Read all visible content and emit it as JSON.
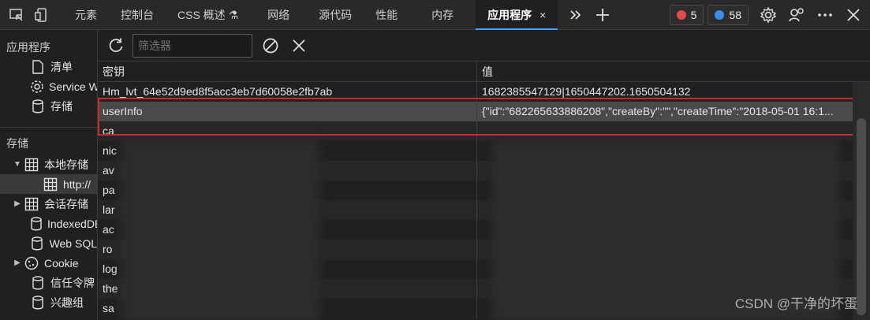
{
  "toolbar": {
    "tabs": [
      {
        "label": "元素"
      },
      {
        "label": "控制台"
      },
      {
        "label": "CSS 概述 ⚗"
      },
      {
        "label": "网络"
      },
      {
        "label": "源代码"
      },
      {
        "label": "性能"
      },
      {
        "label": "内存"
      },
      {
        "label": "应用程序",
        "close": "×"
      }
    ],
    "error_count": "5",
    "message_count": "58"
  },
  "sidebar": {
    "app_header": "应用程序",
    "app_items": [
      {
        "label": "清单"
      },
      {
        "label": "Service Workers"
      },
      {
        "label": "存储"
      }
    ],
    "storage_header": "存储",
    "storage_items": [
      {
        "label": "本地存储"
      },
      {
        "label": "http://"
      },
      {
        "label": "会话存储"
      },
      {
        "label": "IndexedDB"
      },
      {
        "label": "Web SQL"
      },
      {
        "label": "Cookie"
      },
      {
        "label": "信任令牌"
      },
      {
        "label": "兴趣组"
      }
    ]
  },
  "filter": {
    "placeholder": "筛选器"
  },
  "table": {
    "headers": {
      "key": "密钥",
      "value": "值"
    },
    "rows": [
      {
        "key": "Hm_lvt_64e52d9ed8f5acc3eb7d60058e2fb7ab",
        "value": "1682385547129|1650447202.1650504132"
      },
      {
        "key": "userInfo",
        "value": "{\"id\":\"682265633886208\",\"createBy\":\"\",\"createTime\":\"2018-05-01 16:1..."
      },
      {
        "key": "ca",
        "value": ""
      },
      {
        "key": "nic",
        "value": ""
      },
      {
        "key": "av",
        "value": ""
      },
      {
        "key": "pa",
        "value": ""
      },
      {
        "key": "lar",
        "value": ""
      },
      {
        "key": "ac",
        "value": ""
      },
      {
        "key": "ro",
        "value": ""
      },
      {
        "key": "log",
        "value": ""
      },
      {
        "key": "the",
        "value": ""
      },
      {
        "key": "sa",
        "value": ""
      }
    ]
  },
  "watermark": "CSDN @干净的坏蛋",
  "colors": {
    "accent": "#4aa0ff",
    "highlight": "#d2262b",
    "error": "#e34a4a",
    "info": "#3b8eea"
  }
}
